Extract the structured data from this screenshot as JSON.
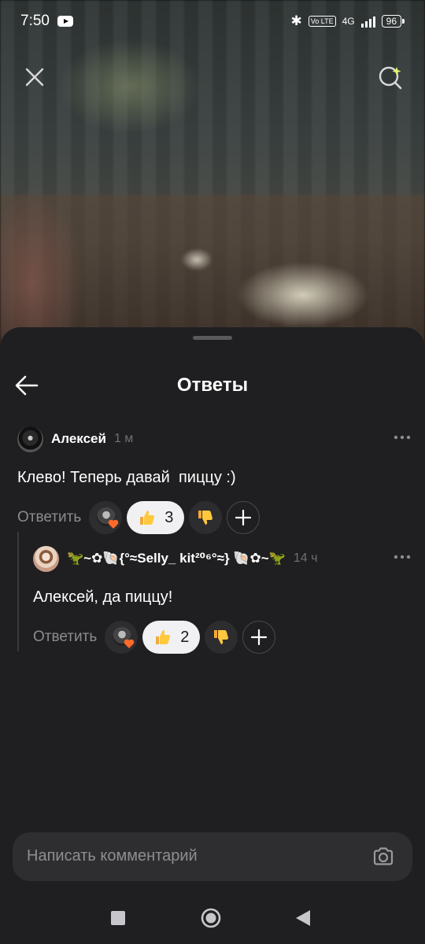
{
  "status_bar": {
    "time": "7:50",
    "battery": "96",
    "network": "4G",
    "volte": "Vo LTE"
  },
  "top": {
    "close_icon": "close-icon",
    "search_icon": "search-spark-icon"
  },
  "sheet": {
    "title": "Ответы"
  },
  "comments": [
    {
      "author": "Алексей",
      "time": "1 м",
      "text": "Клево! Теперь давай  пиццу :)",
      "reply_label": "Ответить",
      "likes": "3"
    },
    {
      "author": "🦖~✿🐚{°≈Selly_ kit²⁰⁶°≈} 🐚✿~🦖",
      "time": "14 ч",
      "text": "Алексей, да пиццу!",
      "reply_label": "Ответить",
      "likes": "2"
    }
  ],
  "input": {
    "placeholder": "Написать комментарий"
  },
  "colors": {
    "sheet_bg": "#1f1f21",
    "pill_bg": "#f1f1f3",
    "accent_heart": "#ff6a2b",
    "muted_text": "#8c8c90"
  }
}
